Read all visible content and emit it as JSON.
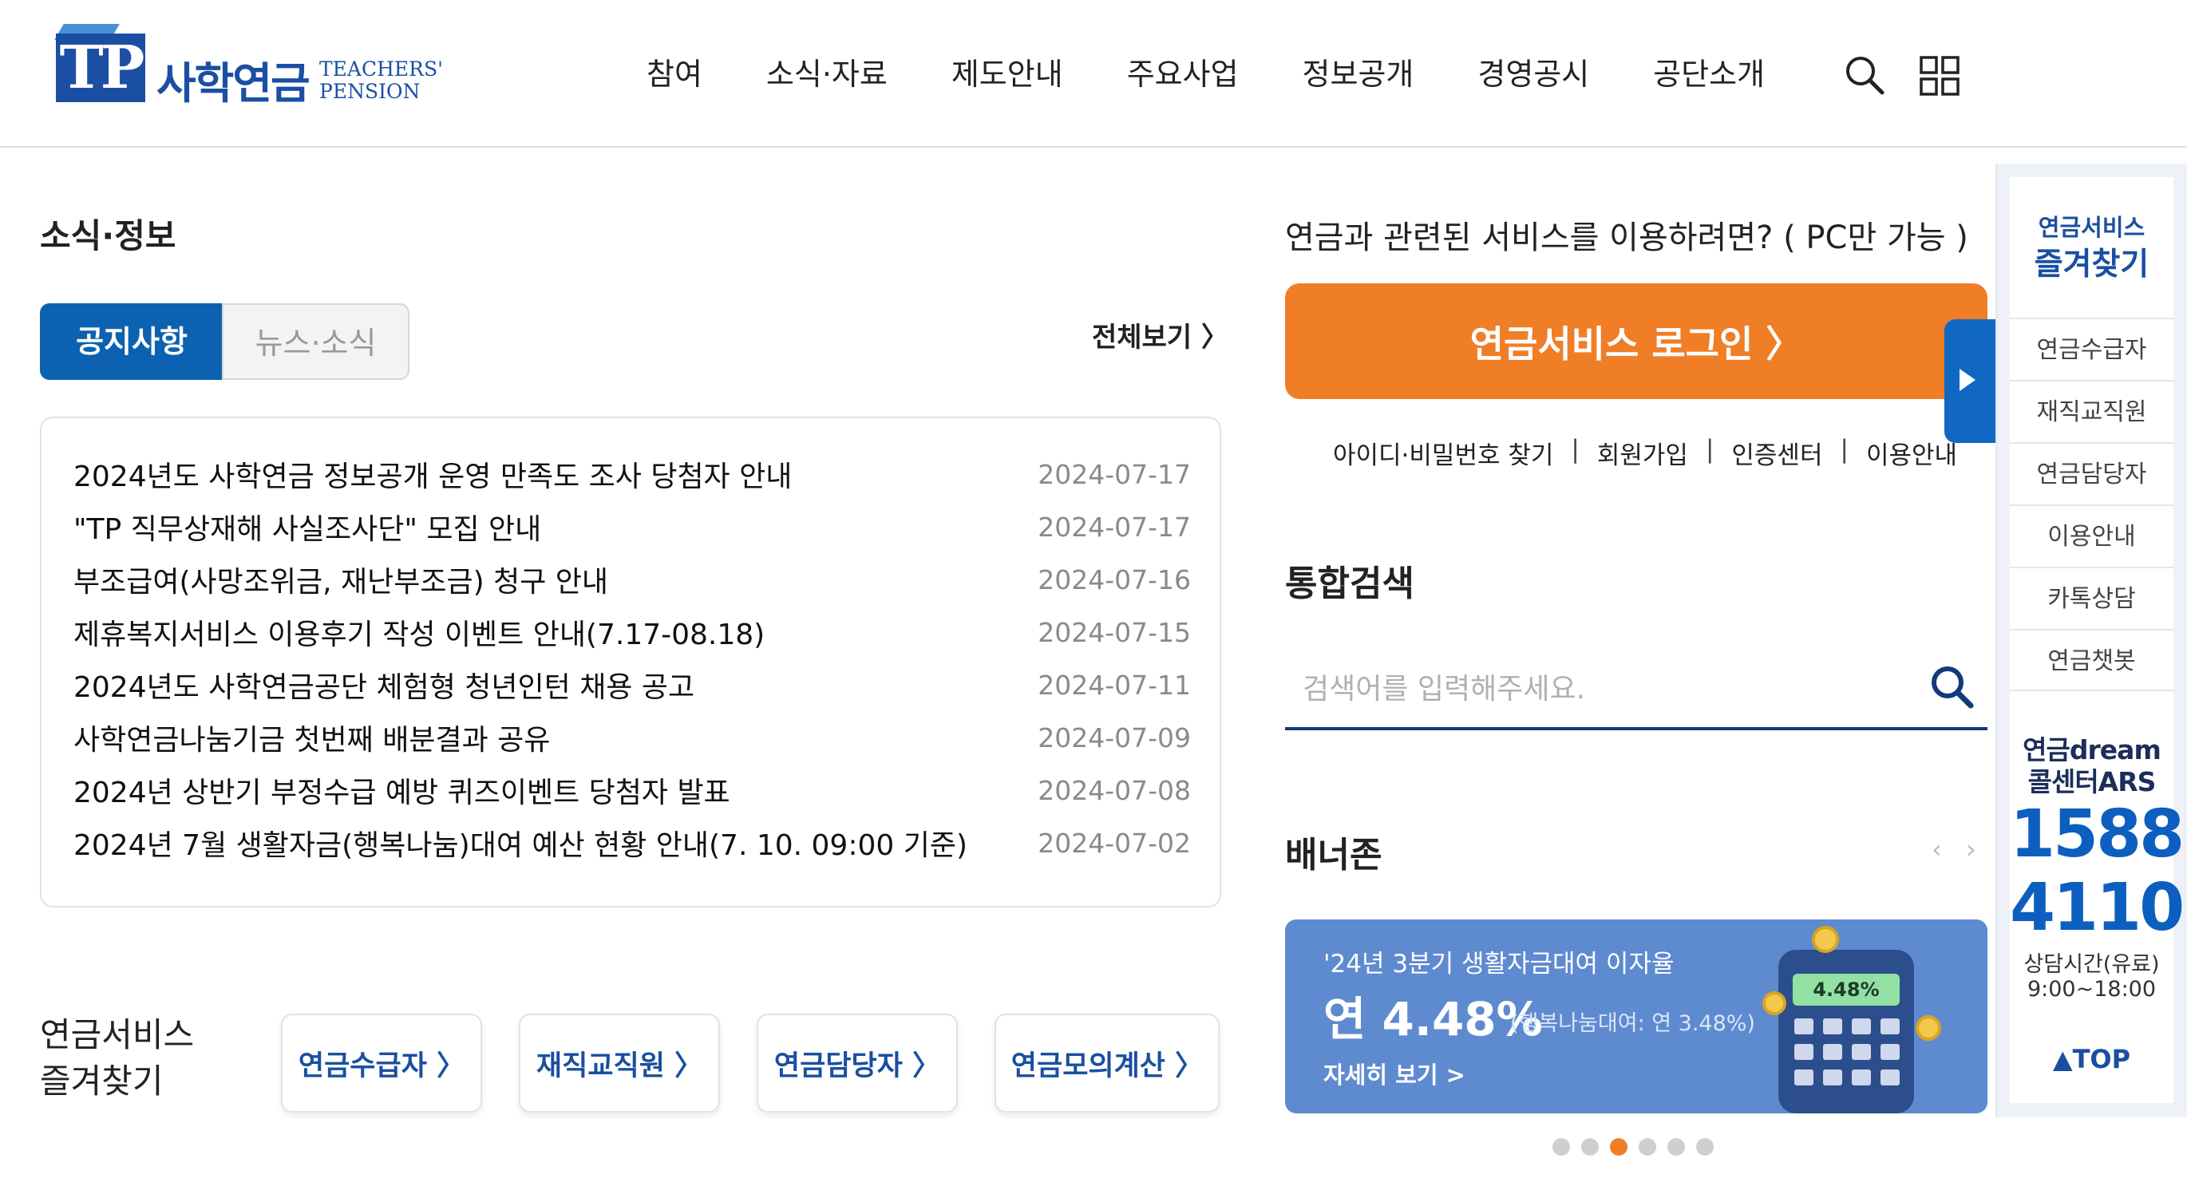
{
  "header": {
    "logo": {
      "mark": "TP",
      "name_ko": "사학연금",
      "name_en_1": "TEACHERS'",
      "name_en_2": "PENSION"
    },
    "nav": [
      "참여",
      "소식·자료",
      "제도안내",
      "주요사업",
      "정보공개",
      "경영공시",
      "공단소개"
    ],
    "icons": {
      "search": "search-icon",
      "menu": "grid-menu-icon"
    }
  },
  "news": {
    "title": "소식·정보",
    "tabs": [
      {
        "label": "공지사항",
        "active": true
      },
      {
        "label": "뉴스·소식",
        "active": false
      }
    ],
    "view_all": "전체보기 〉",
    "items": [
      {
        "title": "2024년도 사학연금 정보공개 운영 만족도 조사 당첨자 안내",
        "date": "2024-07-17"
      },
      {
        "title": "\"TP 직무상재해 사실조사단\" 모집 안내",
        "date": "2024-07-17"
      },
      {
        "title": "부조급여(사망조위금, 재난부조금) 청구 안내",
        "date": "2024-07-16"
      },
      {
        "title": "제휴복지서비스 이용후기 작성 이벤트 안내(7.17-08.18)",
        "date": "2024-07-15"
      },
      {
        "title": "2024년도 사학연금공단 체험형 청년인턴 채용 공고",
        "date": "2024-07-11"
      },
      {
        "title": "사학연금나눔기금 첫번째 배분결과 공유",
        "date": "2024-07-09"
      },
      {
        "title": "2024년 상반기 부정수급 예방 퀴즈이벤트 당첨자 발표",
        "date": "2024-07-08"
      },
      {
        "title": "2024년 7월 생활자금(행복나눔)대여 예산 현황 안내(7. 10. 09:00 기준)",
        "date": "2024-07-02"
      }
    ]
  },
  "favorites": {
    "title_line1": "연금서비스",
    "title_line2": "즐겨찾기",
    "buttons": [
      "연금수급자 〉",
      "재직교직원 〉",
      "연금담당자 〉",
      "연금모의계산 〉"
    ]
  },
  "service": {
    "description": "연금과 관련된 서비스를 이용하려면? ( PC만 가능 )",
    "login_label": "연금서비스 로그인 〉",
    "links": [
      "아이디·비밀번호 찾기",
      "회원가입",
      "인증센터",
      "이용안내"
    ],
    "link_separator": "|"
  },
  "search": {
    "title": "통합검색",
    "placeholder": "검색어를 입력해주세요."
  },
  "banner_zone": {
    "title": "배너존",
    "arrows": "‹ ›",
    "banner": {
      "subtitle": "'24년 3분기 생활자금대여 이자율",
      "rate_label": "연 4.48%",
      "rate_note": "(행복나눔대여: 연 3.48%)",
      "more": "자세히 보기 >",
      "screen_value": "4.48%"
    },
    "dots_count": 6,
    "active_dot": 2
  },
  "quick_panel": {
    "head1": "연금서비스",
    "head2": "즐겨찾기",
    "items": [
      "연금수급자",
      "재직교직원",
      "연금담당자",
      "이용안내",
      "카톡상담",
      "연금챗봇"
    ],
    "ars_line1": "연금dream",
    "ars_line2": "콜센터ARS",
    "ars_number1": "1588",
    "ars_number2": "4110",
    "hours_line1": "상담시간(유료)",
    "hours_line2": "9:00~18:00",
    "top_label": "▲TOP"
  },
  "colors": {
    "primary_blue": "#0c62b0",
    "accent_orange": "#f07e27",
    "banner_blue": "#5e8bd0",
    "logo_blue": "#1b4fa3"
  }
}
